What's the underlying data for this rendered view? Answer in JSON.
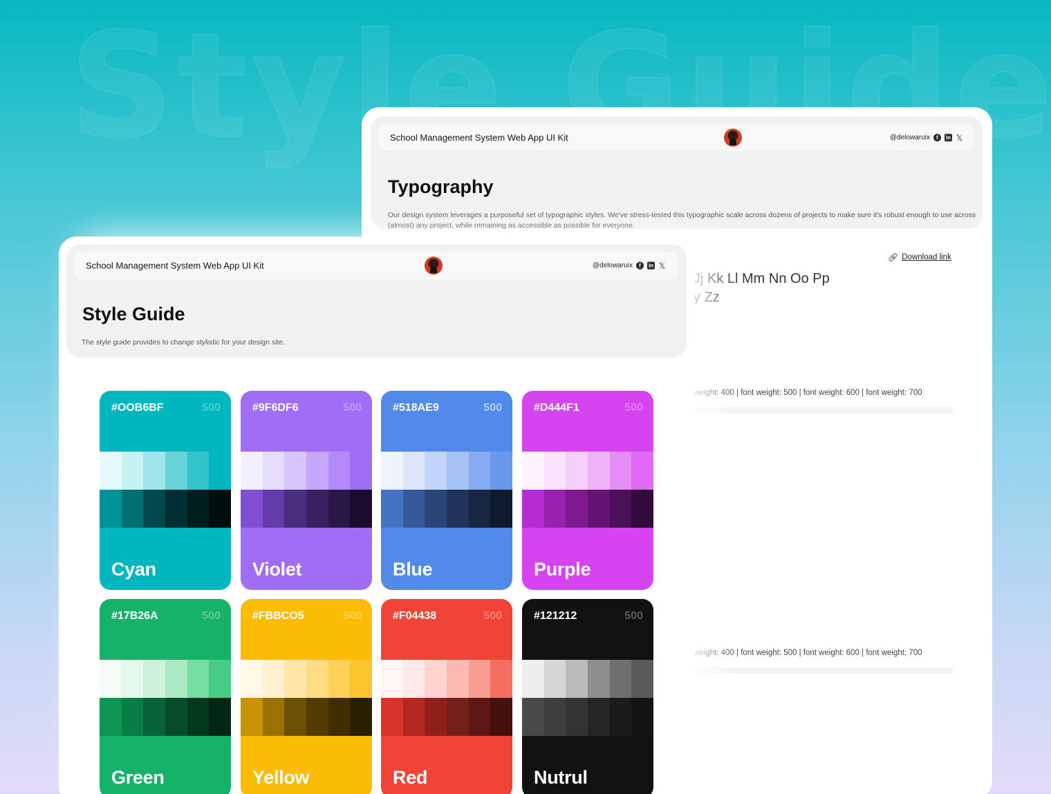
{
  "background_word": "Style Guide",
  "typography_card": {
    "topbar": {
      "title": "School Management System Web App UI Kit",
      "handle": "@delowaruix"
    },
    "title": "Typography",
    "description": "Our design system leverages a purposeful set of typographic styles. We've stress-tested this typographic scale across dozens of projects to make sure it's robust enough to use across (almost) any project, while remaining as accessible as possible for everyone.",
    "download_label": "Download link",
    "alphabet_line1": "Jj Kk Ll Mm Nn Oo Pp",
    "alphabet_line2": "y Zz",
    "weights_line1": "weight: 400  |  font weight: 500  |  font weight: 600  |  font weight: 700",
    "weights_line2": "weight: 400  |  font weight: 500  |  font weight: 600  |  font weight: 700"
  },
  "style_card": {
    "topbar": {
      "title": "School Management System Web App UI Kit",
      "handle": "@delowaruix"
    },
    "title": "Style Guide",
    "description": "The style guide provides to change stylistic for your design site."
  },
  "icons": {
    "facebook": "facebook-icon",
    "linkedin": "linkedin-icon",
    "x": "x-icon",
    "link": "link-icon",
    "avatar": "avatar"
  },
  "swatches": [
    {
      "hex": "#OOB6BF",
      "weight": "500",
      "name": "Cyan",
      "base": "#00b6bf",
      "light": [
        "#e6fbfb",
        "#c5f1f2",
        "#9fe6e8",
        "#66d3d8",
        "#33c4cb",
        "#00b6bf"
      ],
      "dark": [
        "#00939a",
        "#006f74",
        "#00484c",
        "#003033",
        "#001d1f",
        "#000e0f"
      ]
    },
    {
      "hex": "#9F6DF6",
      "weight": "500",
      "name": "Violet",
      "base": "#9f6df6",
      "light": [
        "#f4effe",
        "#e6dcfd",
        "#d7c5fb",
        "#c5a8fa",
        "#b28bf8",
        "#9f6df6"
      ],
      "dark": [
        "#7f51d0",
        "#653da8",
        "#4b2d80",
        "#3a2262",
        "#2a1748",
        "#1b0d30"
      ]
    },
    {
      "hex": "#518AE9",
      "weight": "500",
      "name": "Blue",
      "base": "#518ae9",
      "light": [
        "#eef3fd",
        "#dbe6fb",
        "#c3d5f8",
        "#a6c1f4",
        "#86abf0",
        "#6a98ec"
      ],
      "dark": [
        "#4473c2",
        "#36599a",
        "#2a4577",
        "#20345b",
        "#172642",
        "#0f1a2e"
      ]
    },
    {
      "hex": "#D444F1",
      "weight": "500",
      "name": "Purple",
      "base": "#d444f1",
      "light": [
        "#fdf3fe",
        "#fae4fd",
        "#f5d0fb",
        "#eeb2f8",
        "#e68cf6",
        "#df6af4"
      ],
      "dark": [
        "#b42ecf",
        "#9822ae",
        "#7c1a8e",
        "#621572",
        "#4c1058",
        "#330a3c"
      ]
    },
    {
      "hex": "#17B26A",
      "weight": "500",
      "name": "Green",
      "base": "#17b26a",
      "light": [
        "#f2fcf6",
        "#e4f8ec",
        "#ccf2dc",
        "#a9eac4",
        "#76dda3",
        "#45cd85"
      ],
      "dark": [
        "#0e9554",
        "#0a7c45",
        "#086338",
        "#064d2b",
        "#04391f",
        "#022714"
      ]
    },
    {
      "hex": "#FBBCO5",
      "weight": "500",
      "name": "Yellow",
      "base": "#fbbc05",
      "light": [
        "#fff8e6",
        "#fff1cd",
        "#ffe7aa",
        "#ffdc82",
        "#fdd058",
        "#fcc530"
      ],
      "dark": [
        "#c89405",
        "#9a7204",
        "#6c5003",
        "#523c02",
        "#3e2e02",
        "#2a1f01"
      ]
    },
    {
      "hex": "#F04438",
      "weight": "500",
      "name": "Red",
      "base": "#f04438",
      "light": [
        "#fff5f4",
        "#ffe8e6",
        "#ffd3cf",
        "#ffb9b2",
        "#f99d93",
        "#f46e62"
      ],
      "dark": [
        "#d8342a",
        "#b32820",
        "#8f1f19",
        "#742019",
        "#5e1712",
        "#46100c"
      ]
    },
    {
      "hex": "#121212",
      "weight": "500",
      "name": "Nutrul",
      "base": "#121212",
      "light": [
        "#eeeeee",
        "#d6d6d6",
        "#bbbbbb",
        "#8e8e8e",
        "#6f6f6f",
        "#5a5a5a"
      ],
      "dark": [
        "#4a4a4a",
        "#3e3e3e",
        "#333333",
        "#262626",
        "#1b1b1b",
        "#141414"
      ]
    }
  ]
}
